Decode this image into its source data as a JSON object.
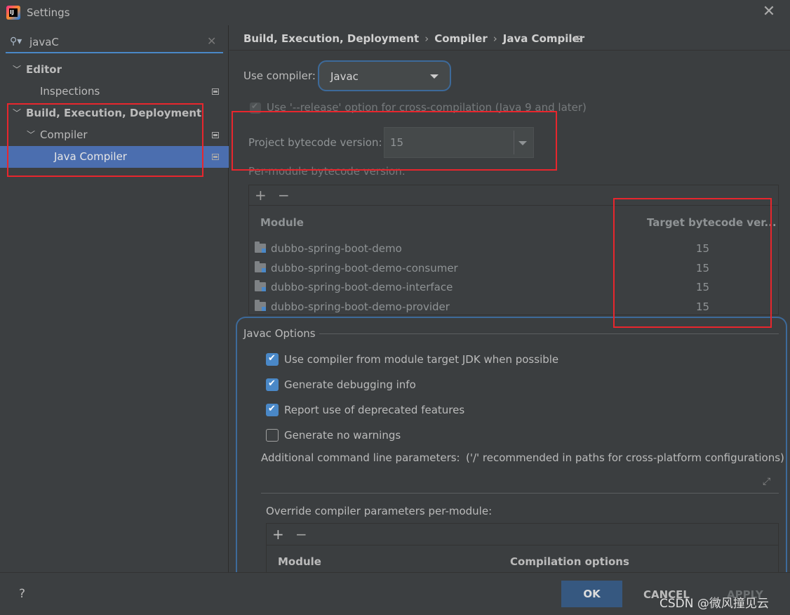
{
  "window": {
    "title": "Settings",
    "close_glyph": "✕",
    "logo_text": "IJ"
  },
  "search": {
    "value": "javaC",
    "icon": "search-icon",
    "clear_glyph": "✕"
  },
  "sidebar": {
    "items": [
      {
        "label": "Editor",
        "expanded": true,
        "level": 0
      },
      {
        "label": "Inspections",
        "level": 1
      },
      {
        "label": "Build, Execution, Deployment",
        "expanded": true,
        "level": 0
      },
      {
        "label": "Compiler",
        "expanded": true,
        "level": 1
      },
      {
        "label": "Java Compiler",
        "selected": true,
        "level": 2
      }
    ]
  },
  "breadcrumb": {
    "items": [
      "Build, Execution, Deployment",
      "Compiler",
      "Java Compiler"
    ],
    "sep": "›"
  },
  "compiler": {
    "use_compiler_label": "Use compiler:",
    "use_compiler_value": "Javac",
    "release_option_label": "Use '--release' option for cross-compilation (Java 9 and later)",
    "release_option_checked": true,
    "project_bytecode_label": "Project bytecode version:",
    "project_bytecode_value": "15",
    "per_module_label": "Per-module bytecode version:",
    "add_glyph": "+",
    "remove_glyph": "−",
    "table": {
      "headers": [
        "Module",
        "Target bytecode ver..."
      ],
      "rows": [
        {
          "module": "dubbo-spring-boot-demo",
          "version": "15"
        },
        {
          "module": "dubbo-spring-boot-demo-consumer",
          "version": "15"
        },
        {
          "module": "dubbo-spring-boot-demo-interface",
          "version": "15"
        },
        {
          "module": "dubbo-spring-boot-demo-provider",
          "version": "15"
        }
      ]
    }
  },
  "javac_options": {
    "title": "Javac Options",
    "checkboxes": [
      {
        "label": "Use compiler from module target JDK when possible",
        "checked": true
      },
      {
        "label": "Generate debugging info",
        "checked": true
      },
      {
        "label": "Report use of deprecated features",
        "checked": true
      },
      {
        "label": "Generate no warnings",
        "checked": false
      }
    ],
    "additional_params_label": "Additional command line parameters:",
    "additional_params_hint": "('/' recommended in paths for cross-platform configurations)",
    "override_label": "Override compiler parameters per-module:",
    "override_headers": [
      "Module",
      "Compilation options"
    ]
  },
  "footer": {
    "help": "?",
    "ok": "OK",
    "cancel": "CANCEL",
    "apply": "APPLY",
    "watermark": "CSDN @微风撞见云"
  },
  "colors": {
    "accent": "#4a88c7",
    "selection": "#4b6eaf",
    "annotation_red": "#e8262d",
    "ok_button": "#365880"
  }
}
